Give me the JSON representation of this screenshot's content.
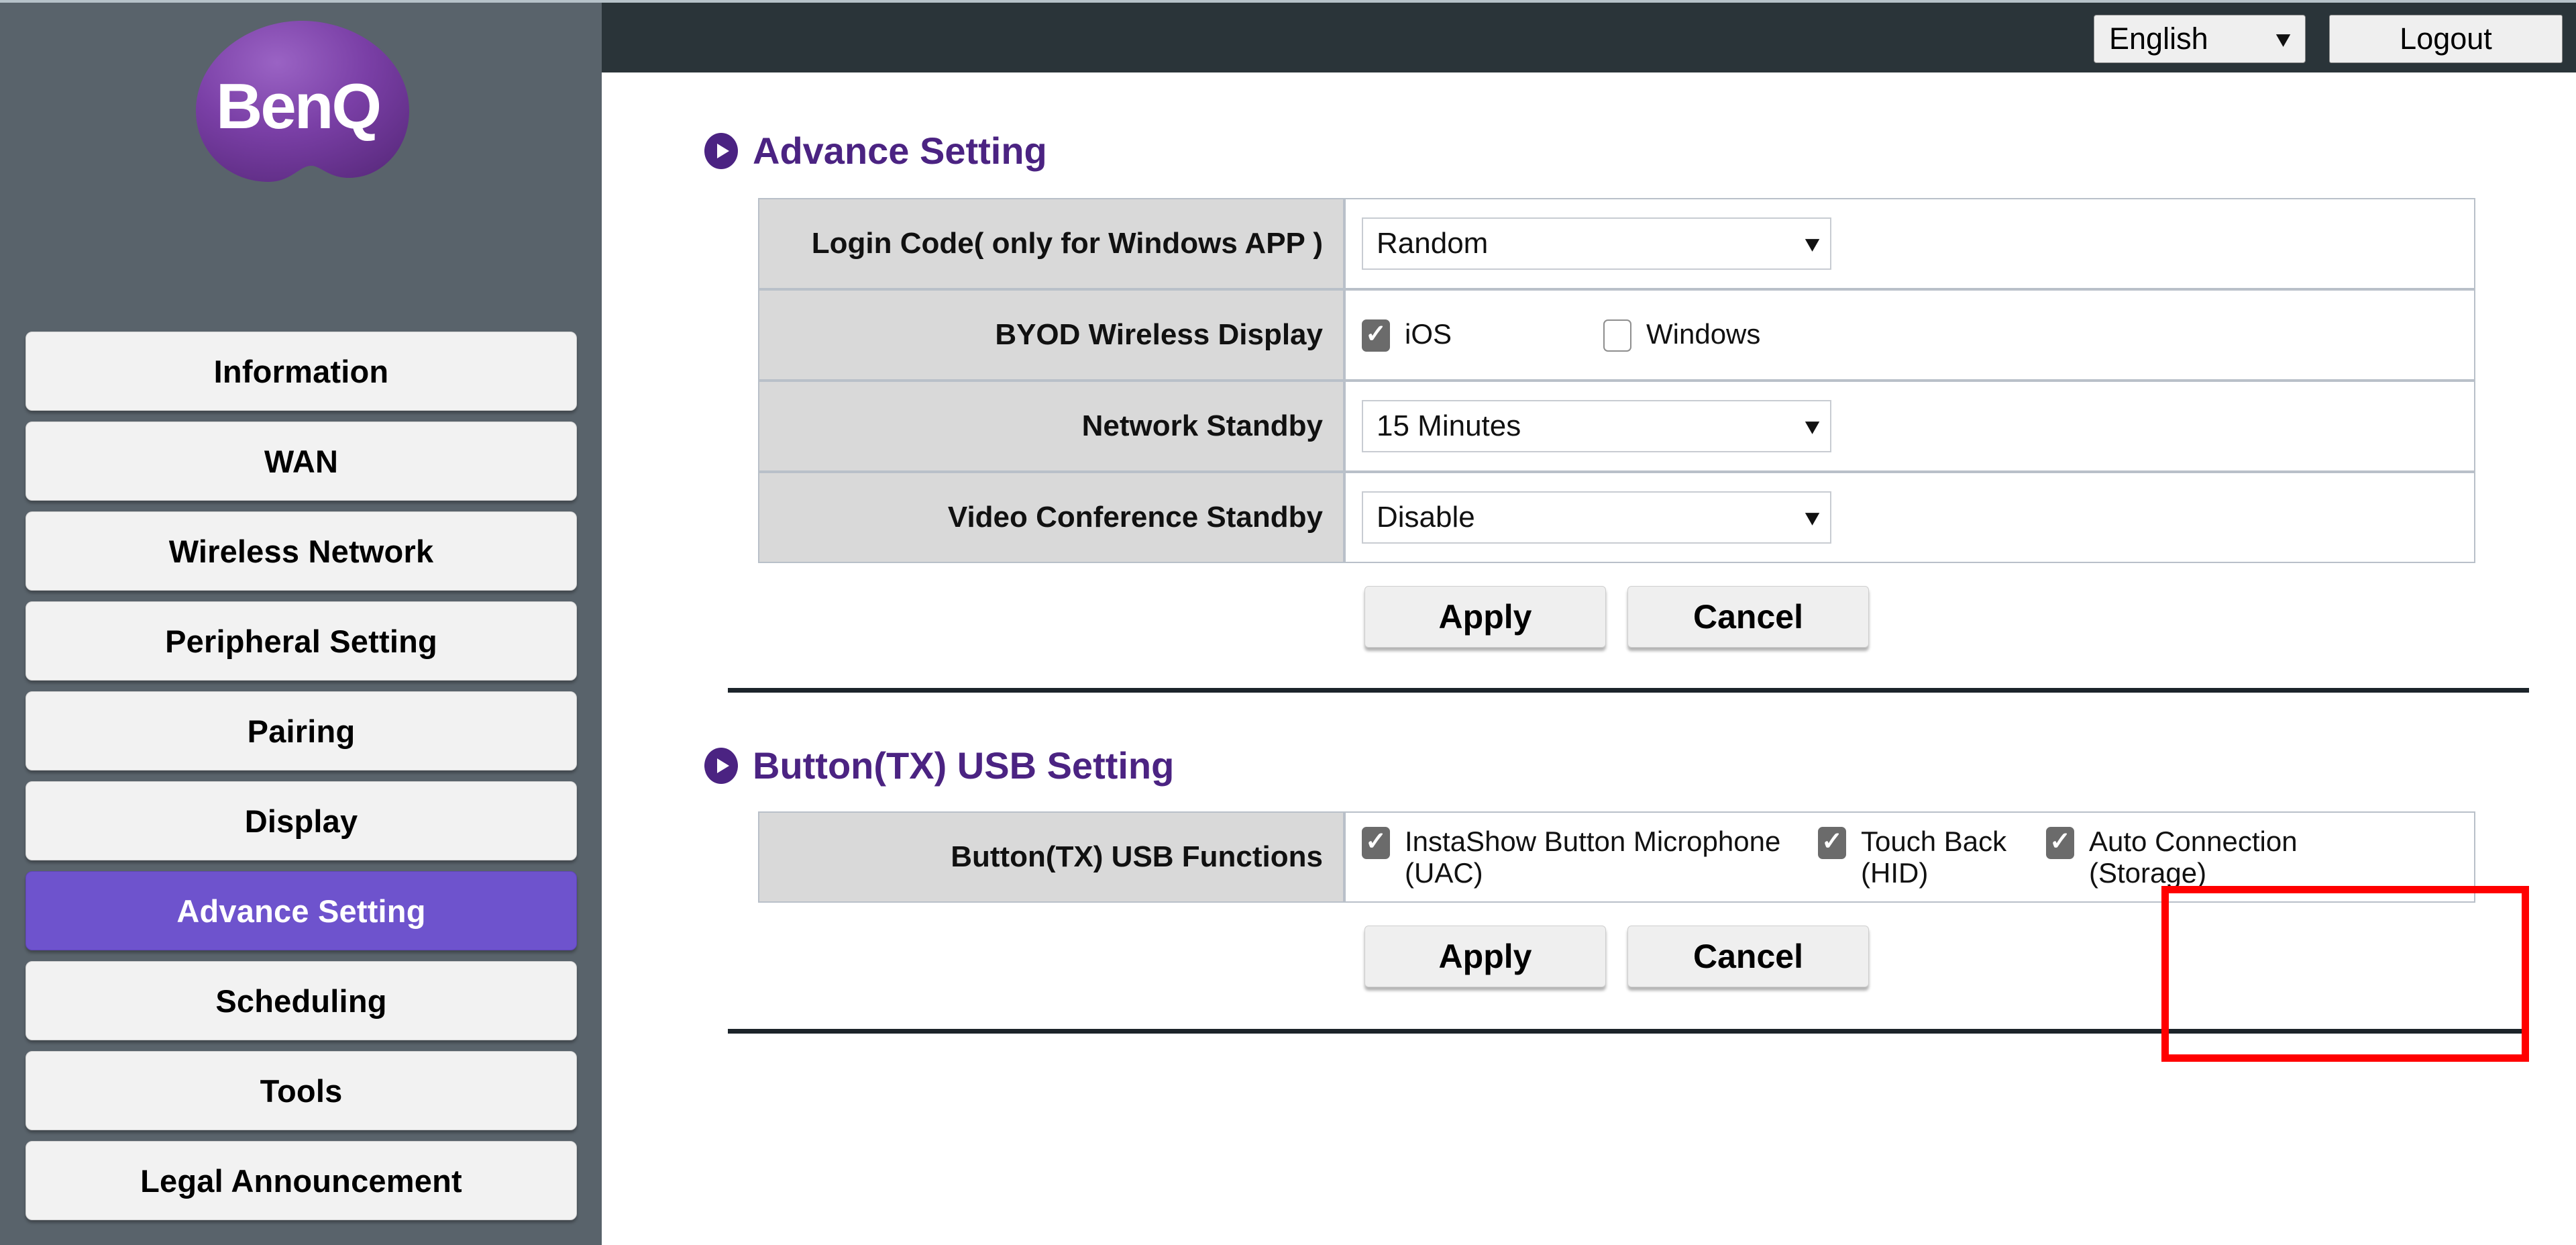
{
  "brand": {
    "logo_text": "BenQ",
    "accent_purple": "#6e53cd",
    "heading_purple": "#4b2382",
    "sidebar_bg": "#59636b",
    "topbar_bg": "#2a3439",
    "highlight_red": "#ff0000"
  },
  "topbar": {
    "language_value": "English",
    "logout_label": "Logout"
  },
  "sidebar": {
    "items": [
      {
        "label": "Information",
        "active": false
      },
      {
        "label": "WAN",
        "active": false
      },
      {
        "label": "Wireless Network",
        "active": false
      },
      {
        "label": "Peripheral Setting",
        "active": false
      },
      {
        "label": "Pairing",
        "active": false
      },
      {
        "label": "Display",
        "active": false
      },
      {
        "label": "Advance Setting",
        "active": true
      },
      {
        "label": "Scheduling",
        "active": false
      },
      {
        "label": "Tools",
        "active": false
      },
      {
        "label": "Legal Announcement",
        "active": false
      }
    ]
  },
  "advance_setting": {
    "heading": "Advance Setting",
    "rows": {
      "login_code": {
        "label": "Login Code( only for Windows APP )",
        "value": "Random"
      },
      "byod": {
        "label": "BYOD Wireless Display",
        "options": [
          {
            "label": "iOS",
            "checked": true
          },
          {
            "label": "Windows",
            "checked": false
          }
        ]
      },
      "network_standby": {
        "label": "Network Standby",
        "value": "15 Minutes"
      },
      "video_conference_standby": {
        "label": "Video Conference Standby",
        "value": "Disable"
      }
    },
    "apply_label": "Apply",
    "cancel_label": "Cancel"
  },
  "usb_setting": {
    "heading": "Button(TX) USB Setting",
    "row_label": "Button(TX) USB Functions",
    "options": [
      {
        "label": "InstaShow Button Microphone\n(UAC)",
        "checked": true
      },
      {
        "label": "Touch Back\n(HID)",
        "checked": true
      },
      {
        "label": "Auto Connection\n(Storage)",
        "checked": true
      }
    ],
    "apply_label": "Apply",
    "cancel_label": "Cancel"
  }
}
